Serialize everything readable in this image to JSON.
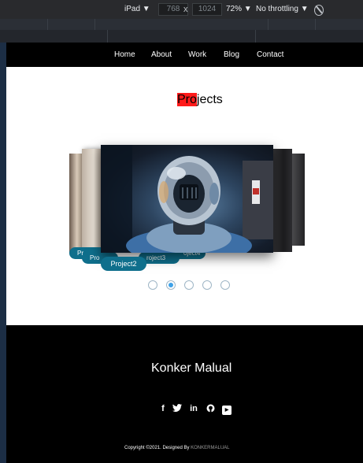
{
  "devtools": {
    "device": "iPad",
    "width": "768",
    "height": "1024",
    "times": "x",
    "zoom": "72%",
    "throttling": "No throttling",
    "dropdown_glyph": "▼"
  },
  "nav": {
    "items": [
      "Home",
      "About",
      "Work",
      "Blog",
      "Contact"
    ]
  },
  "section": {
    "title_highlight": "Pro",
    "title_rest": "jects"
  },
  "carousel": {
    "captions": {
      "far_left": "Pr",
      "left": "Pro",
      "right": "oject4",
      "right2": "roject3",
      "main": "Project2"
    },
    "dots_total": 5,
    "active_dot": 2
  },
  "footer": {
    "name": "Konker Malual",
    "social_icons": [
      "facebook-icon",
      "twitter-icon",
      "linkedin-icon",
      "github-icon",
      "youtube-icon"
    ],
    "copyright_text": "Copyright ©2021. Designed By",
    "brand": "KONKERMALUAL"
  },
  "colors": {
    "accent_red": "#ff1a1a",
    "caption_teal": "#0f6f8c",
    "active_dot": "#3fa2e8"
  }
}
